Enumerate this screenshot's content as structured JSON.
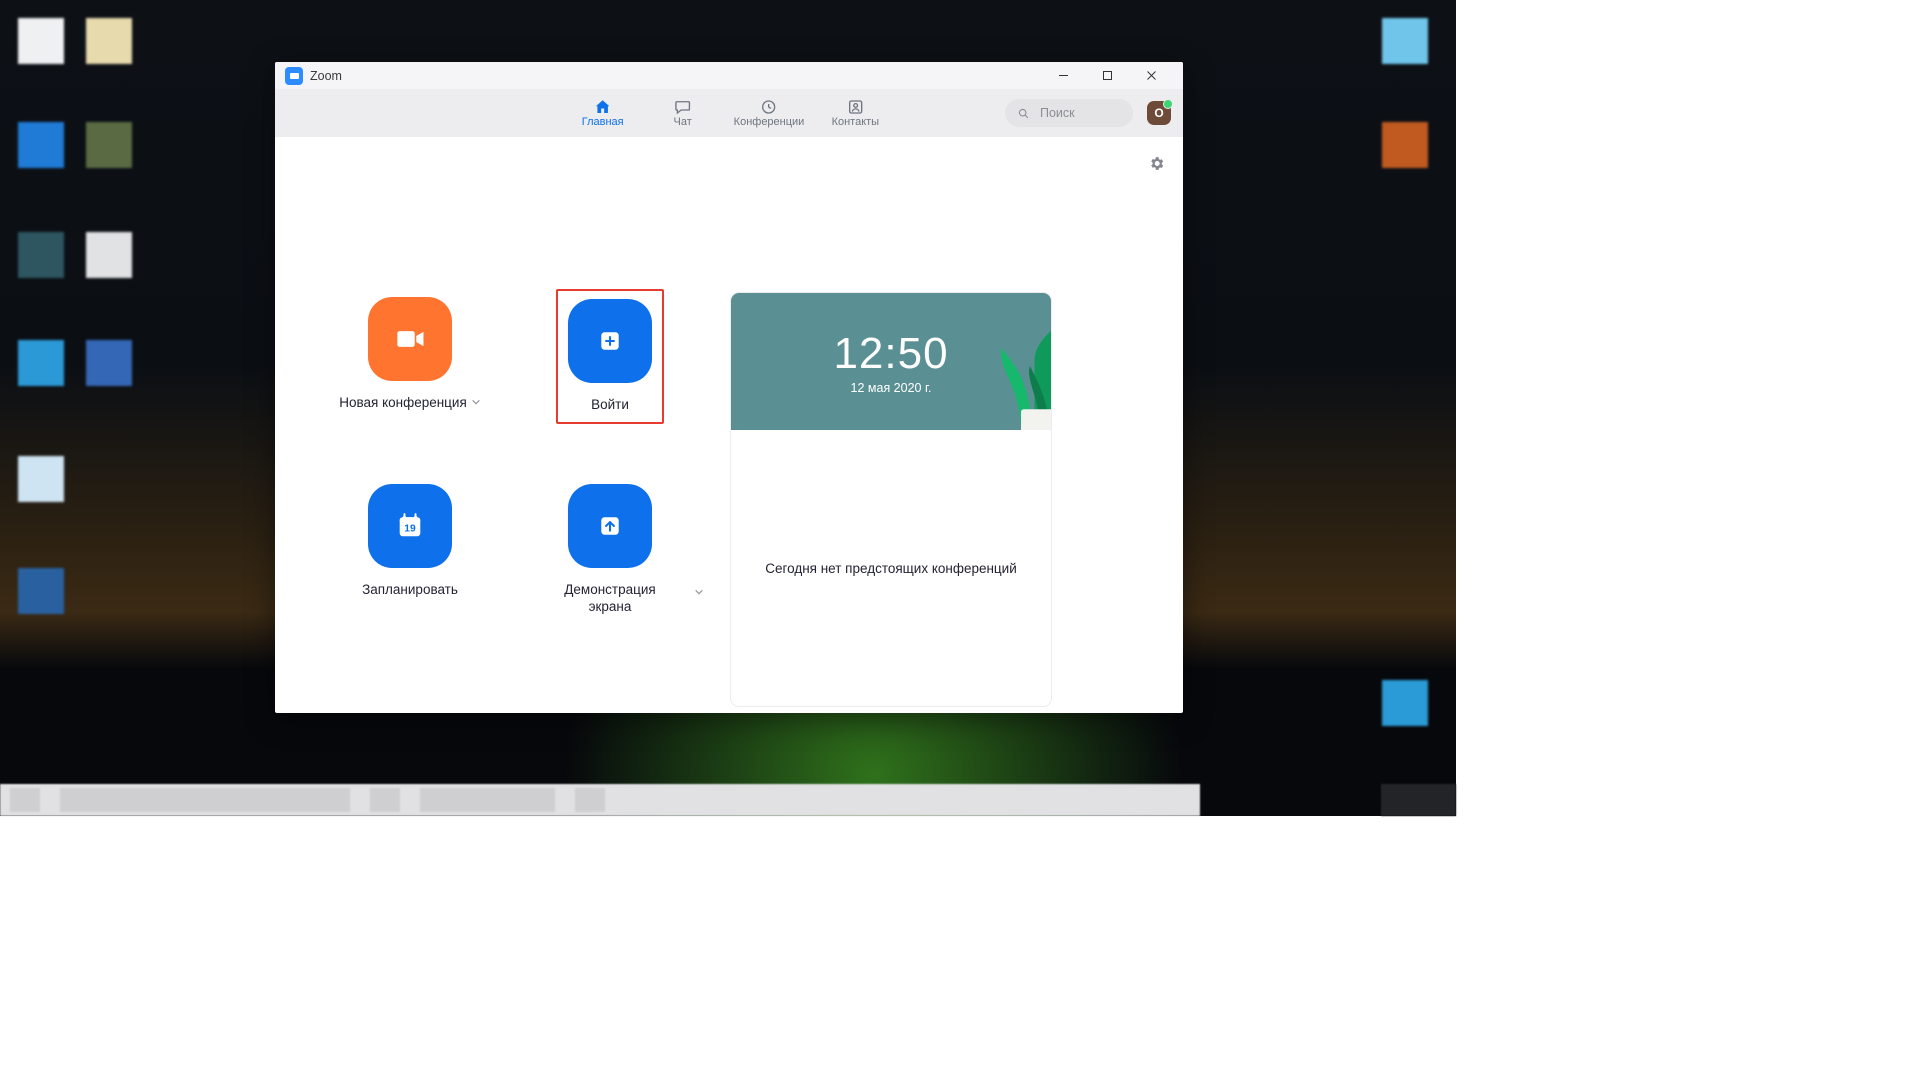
{
  "window": {
    "title": "Zoom"
  },
  "nav": {
    "items": [
      {
        "label": "Главная"
      },
      {
        "label": "Чат"
      },
      {
        "label": "Конференции"
      },
      {
        "label": "Контакты"
      }
    ]
  },
  "search": {
    "placeholder": "Поиск"
  },
  "avatar": {
    "initial": "O"
  },
  "actions": {
    "new_meeting": {
      "label": "Новая конференция"
    },
    "join": {
      "label": "Войти"
    },
    "schedule": {
      "label": "Запланировать",
      "calendar_day": "19"
    },
    "share": {
      "label": "Демонстрация\nэкрана"
    }
  },
  "info": {
    "time": "12:50",
    "date": "12 мая 2020 г.",
    "empty_message": "Сегодня нет предстоящих конференций"
  }
}
